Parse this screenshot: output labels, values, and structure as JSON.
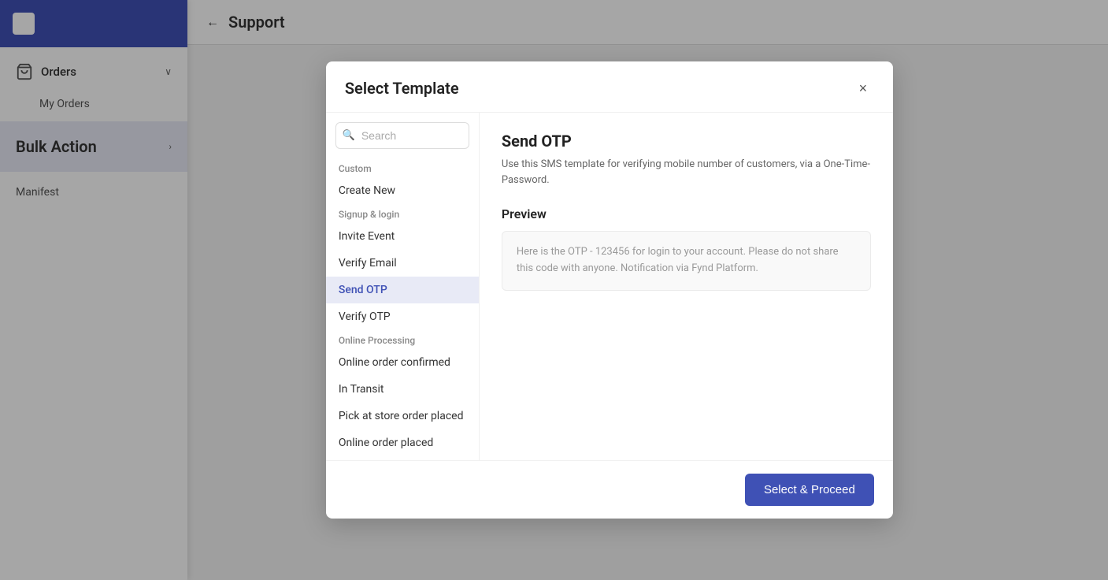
{
  "sidebar": {
    "orders_label": "Orders",
    "my_orders_label": "My Orders",
    "bulk_action_label": "Bulk Action",
    "manifest_label": "Manifest"
  },
  "background": {
    "back_label": "←",
    "page_title": "Support"
  },
  "modal": {
    "title": "Select Template",
    "close_label": "×",
    "search_placeholder": "Search",
    "categories": [
      {
        "name": "Custom",
        "items": [
          "Create New"
        ]
      },
      {
        "name": "Signup & login",
        "items": [
          "Invite Event",
          "Verify Email",
          "Send OTP",
          "Verify OTP"
        ]
      },
      {
        "name": "Online Processing",
        "items": [
          "Online order confirmed",
          "In Transit",
          "Pick at store order placed",
          "Online order placed"
        ]
      }
    ],
    "active_item": "Send OTP",
    "template": {
      "name": "Send OTP",
      "description": "Use this SMS template for verifying mobile number of customers, via a One-Time-Password.",
      "preview_label": "Preview",
      "preview_text": "Here is the OTP - 123456 for login to your account. Please do not share this code with anyone. Notification via Fynd Platform."
    },
    "select_proceed_label": "Select & Proceed"
  }
}
